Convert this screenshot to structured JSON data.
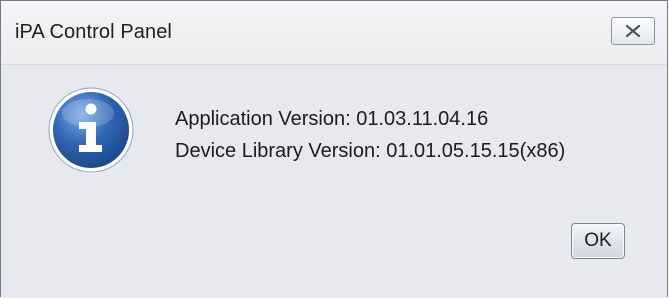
{
  "window": {
    "title": "iPA Control Panel",
    "close_icon": "close-x-icon"
  },
  "dialog": {
    "icon": "information-icon",
    "messages": [
      "Application Version: 01.03.11.04.16",
      "Device Library Version: 01.01.05.15.15(x86)"
    ],
    "ok_label": "OK"
  },
  "colors": {
    "icon_blue": "#2a5fa8",
    "dialog_background": "#e8e9ee"
  }
}
